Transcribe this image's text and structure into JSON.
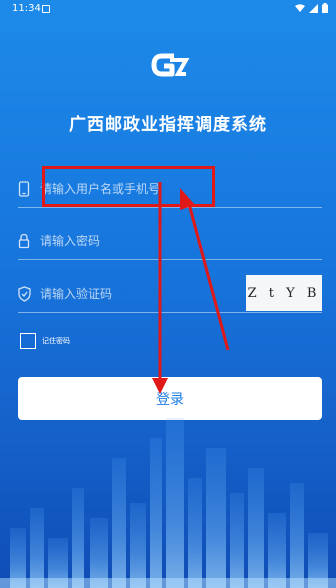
{
  "status_bar": {
    "time": "11:34"
  },
  "app": {
    "title": "广西邮政业指挥调度系统"
  },
  "login_form": {
    "username_placeholder": "请输入用户名或手机号",
    "password_placeholder": "请输入密码",
    "captcha_placeholder": "请输入验证码",
    "captcha_text": "Z t Y B",
    "remember_label": "记住密码",
    "remember_checked": false,
    "login_label": "登录"
  },
  "icons": {
    "logo": "app-logo",
    "username": "phone-icon",
    "password": "lock-icon",
    "captcha": "shield-icon"
  },
  "colors": {
    "background_top": "#1d8ae9",
    "background_bottom": "#0f4db6",
    "button_text": "#1f7fe3",
    "annotation": "#e01818"
  }
}
